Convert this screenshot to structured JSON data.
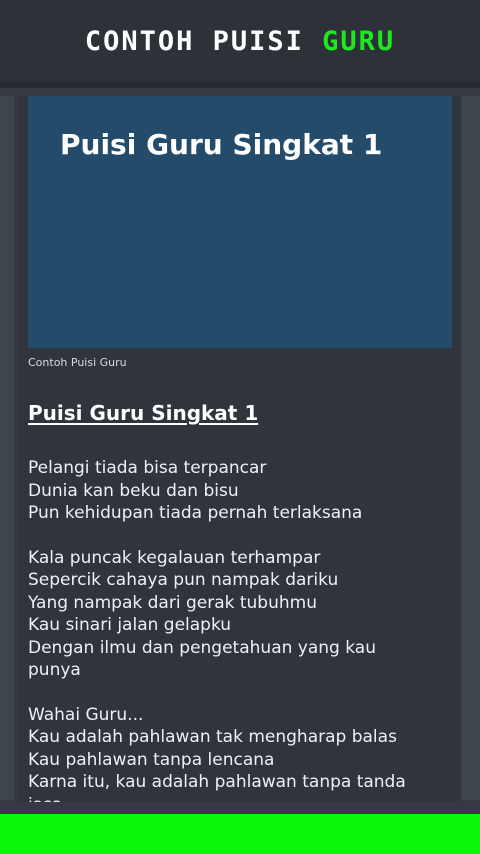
{
  "header": {
    "title_main": "CONTOH PUISI ",
    "title_accent": "GURU"
  },
  "article": {
    "image_title": "Puisi Guru Singkat 1",
    "image_caption": "Contoh Puisi Guru",
    "heading": "Puisi Guru Singkat 1",
    "stanzas": [
      [
        "Pelangi tiada bisa terpancar",
        "Dunia kan beku dan bisu",
        "Pun kehidupan tiada pernah terlaksana"
      ],
      [
        "Kala puncak kegalauan terhampar",
        "Sepercik cahaya pun nampak dariku",
        "Yang nampak dari gerak tubuhmu",
        "Kau sinari jalan gelapku",
        "Dengan ilmu dan pengetahuan yang kau",
        "punya"
      ],
      [
        "Wahai Guru...",
        "Kau adalah pahlawan tak mengharap balas",
        "Kau pahlawan tanpa lencana",
        "Karna itu, kau adalah pahlawan tanpa tanda",
        "jasa"
      ]
    ]
  },
  "colors": {
    "accent_green": "#1ee81e",
    "bottom_bar": "#0bf80b",
    "header_bg": "#2d3239",
    "card_bg": "#30353d",
    "image_bg": "#254b6b"
  }
}
